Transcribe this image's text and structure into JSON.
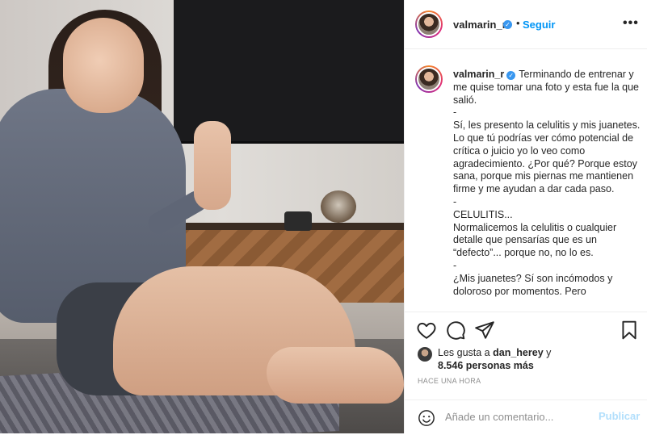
{
  "post": {
    "username": "valmarin_r",
    "follow_label": "Seguir",
    "separator": "•",
    "more_label": "•••"
  },
  "caption": {
    "username": "valmarin_r",
    "paragraphs": [
      "Terminando de entrenar y me quise tomar una foto y esta fue la que salió.",
      "-",
      "Sí, les presento la celulitis y mis juanetes. Lo que tú podrías ver cómo potencial de crítica o juicio yo lo veo como agradecimiento. ¿Por qué? Porque estoy sana, porque mis piernas me mantienen firme y me ayudan a dar cada paso.",
      "-",
      "CELULITIS...",
      "Normalicemos la celulitis o cualquier detalle que pensarías que es un “defecto”... porque no, no lo es.",
      "-",
      "¿Mis juanetes? Sí son incómodos y doloroso por momentos. Pero"
    ]
  },
  "likes": {
    "prefix": "Les gusta a",
    "liker": "dan_herey",
    "conjunction": "y",
    "count_text": "8.546 personas más"
  },
  "timestamp": "HACE UNA HORA",
  "comment_box": {
    "placeholder": "Añade un comentario...",
    "publish_label": "Publicar"
  },
  "icons": {
    "like": "heart-icon",
    "comment": "comment-icon",
    "share": "paper-plane-icon",
    "save": "bookmark-icon",
    "emoji": "emoji-icon",
    "verified": "verified-badge-icon"
  },
  "colors": {
    "link_blue": "#0095f6",
    "verified_blue": "#3897f0",
    "publish_disabled": "#b2dffc",
    "muted_text": "#8e8e8e"
  }
}
